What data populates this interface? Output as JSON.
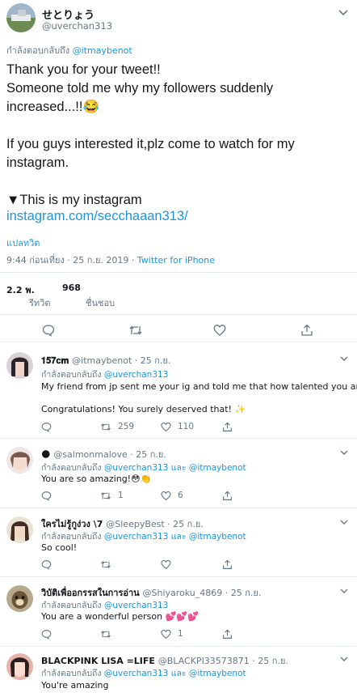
{
  "main_tweet": {
    "display_name": "せとりょう",
    "handle": "@uverchan313",
    "reply_prefix": "กำลังตอบกลับถึง",
    "reply_to": "@itmaybenot",
    "text": "Thank you for your tweet!!\nSomeone told me why my followers suddenly\nincreased...!!😂\n\nIf you guys interested it,plz come to watch for my\ninstagram.\n\n▼This is my instagram",
    "link": "instagram.com/secchaaan313/",
    "translate_label": "แปลทวิต",
    "timestamp": "9:44 ก่อนเที่ยง · 25 ก.ย. 2019 ·",
    "source": "Twitter for iPhone",
    "retweets_count": "2.2 พ.",
    "retweets_label": "รีทวิต",
    "likes_count": "968",
    "likes_label": "ชื่นชอบ"
  },
  "replies": [
    {
      "name": "𝟏𝟓𝟕𝐜𝐦",
      "handle": "@itmaybenot · 25 ก.ย.",
      "reply_prefix": "กำลังตอบกลับถึง",
      "reply_to": "@uverchan313",
      "line1": "My friend from jp sent me your ig and told me that how talented you are!",
      "line2": "Congratulations! You surely deserved that! ✨",
      "retweets": "259",
      "likes": "110"
    },
    {
      "name": "🌑",
      "handle": "@salmonmalove · 25 ก.ย.",
      "reply_prefix": "กำลังตอบกลับถึง",
      "reply_to": "@uverchan313 และ @itmaybenot",
      "line1": "You are so amazing!😳👏",
      "retweets": "1",
      "likes": "6"
    },
    {
      "name": "ใครไม่รู้กูง่วง \\7",
      "handle": "@SleepyBest · 25 ก.ย.",
      "reply_prefix": "กำลังตอบกลับถึง",
      "reply_to": "@uverchan313 และ @itmaybenot",
      "line1": "So cool!"
    },
    {
      "name": "วิบัติเพื่ออกรรสในการอ่าน",
      "handle": "@Shiyaroku_4869 · 25 ก.ย.",
      "reply_prefix": "กำลังตอบกลับถึง",
      "reply_to": "@uverchan313",
      "line1": "You are a wonderful person 💕💕💕",
      "likes": "1"
    },
    {
      "name": "BLACKPINK LISA =LIFE",
      "handle": "@BLACKPI33573871 · 25 ก.ย.",
      "reply_prefix": "กำลังตอบกลับถึง",
      "reply_to": "@uverchan313 และ @itmaybenot",
      "line1": "You're amazing"
    }
  ],
  "colors": {
    "link": "#1b95e0",
    "muted": "#657786",
    "divider": "#e6ecf0"
  }
}
